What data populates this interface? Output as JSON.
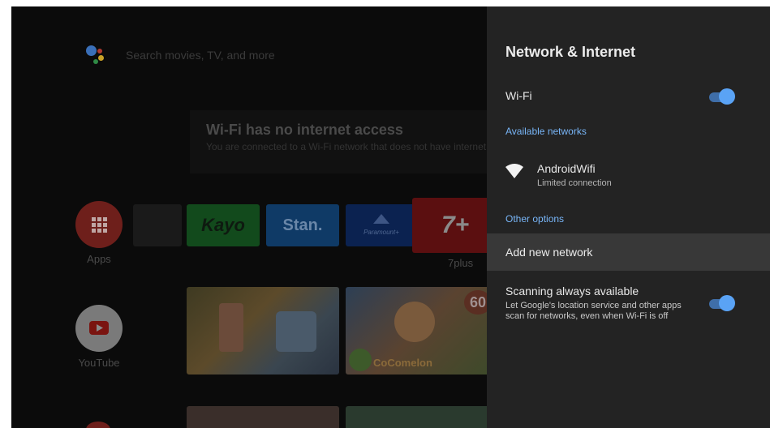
{
  "home": {
    "search_placeholder": "Search movies, TV, and more",
    "toast": {
      "title": "Wi-Fi has no internet access",
      "body": "You are connected to a Wi-Fi network that does not have internet access"
    },
    "apps_label": "Apps",
    "youtube_label": "YouTube",
    "channels": {
      "kayo": "Kayo",
      "stan": "Stan.",
      "paramount": "Paramount+",
      "sevenplus": "7+",
      "sevenplus_label": "7plus"
    },
    "thumb_badge": "60",
    "cocomelon": "CoComelon"
  },
  "panel": {
    "title": "Network & Internet",
    "wifi_label": "Wi-Fi",
    "wifi_on": true,
    "available_header": "Available networks",
    "network": {
      "name": "AndroidWifi",
      "status": "Limited connection"
    },
    "other_header": "Other options",
    "add_network": "Add new network",
    "scanning": {
      "label": "Scanning always available",
      "description": "Let Google's location service and other apps scan for networks, even when Wi-Fi is off",
      "on": true
    }
  },
  "colors": {
    "panel_bg": "#232323",
    "accent_blue": "#5aa3f5",
    "section_blue": "#78b5f7",
    "highlight_row": "#383838"
  }
}
